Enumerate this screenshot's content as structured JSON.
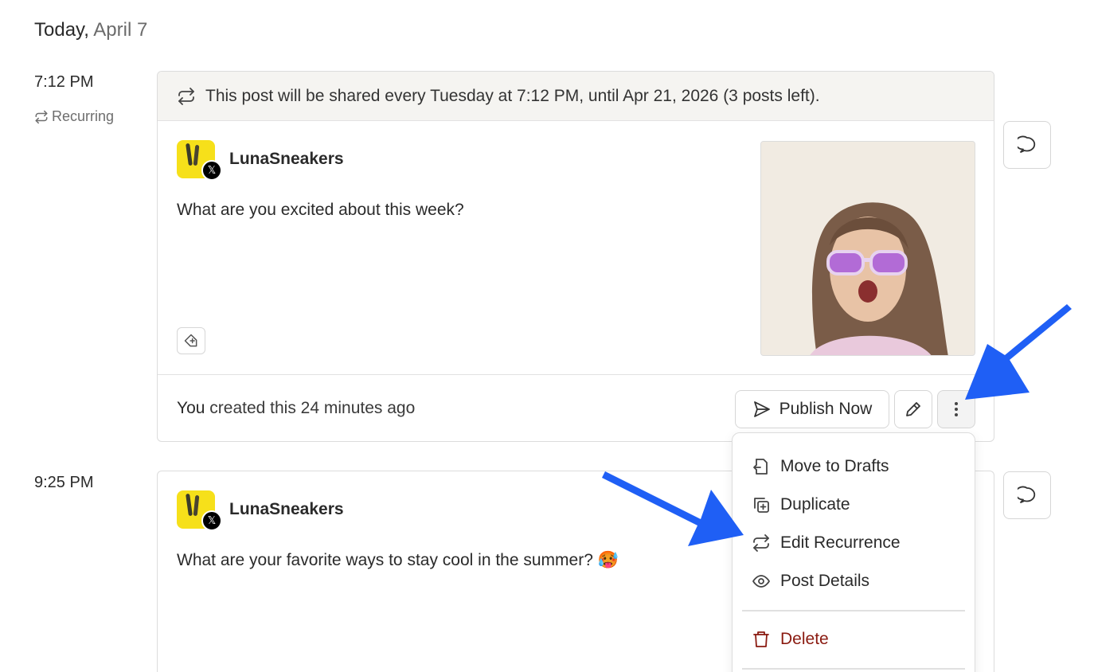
{
  "day": {
    "label": "Today,",
    "date": "April 7"
  },
  "posts": [
    {
      "time": "7:12 PM",
      "recurring_label": "Recurring",
      "banner": "This post will be shared every Tuesday at 7:12 PM, until Apr 21, 2026 (3 posts left).",
      "account": "LunaSneakers",
      "text": "What are you excited about this week?",
      "footer": {
        "who": "You",
        "rest": " created this 24 minutes ago"
      },
      "publish_label": "Publish Now"
    },
    {
      "time": "9:25 PM",
      "account": "LunaSneakers",
      "text": "What are your favorite ways to stay cool in the summer? 🥵"
    }
  ],
  "menu": {
    "items": [
      {
        "label": "Move to Drafts",
        "icon": "move-to-drafts-icon"
      },
      {
        "label": "Duplicate",
        "icon": "duplicate-icon"
      },
      {
        "label": "Edit Recurrence",
        "icon": "recurrence-icon"
      },
      {
        "label": "Post Details",
        "icon": "eye-icon"
      }
    ],
    "delete_label": "Delete"
  },
  "colors": {
    "arrow": "#1f5ff5",
    "danger": "#8a1a10",
    "banner_bg": "#f5f4f1",
    "avatar_bg": "#f6e01a"
  }
}
